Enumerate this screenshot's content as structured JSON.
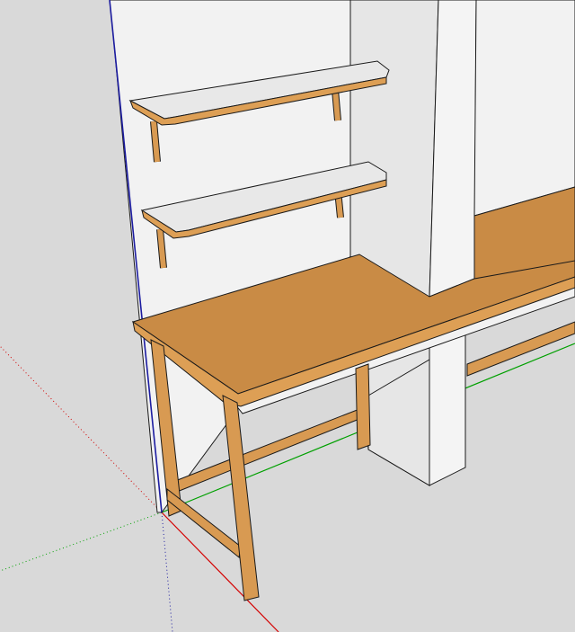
{
  "scene": {
    "description_visible_text": "",
    "colors": {
      "background": "#d9d9d9",
      "wall": "#f2f2f2",
      "wall_shade": "#e4e4e4",
      "shelf_top": "#e8e8e8",
      "wood_top": "#c98b45",
      "wood_edge": "#dd9f55",
      "wood_leg": "#d89a52",
      "outline": "#1a1a1a",
      "axis_red": "#d40000",
      "axis_green": "#00a000",
      "axis_blue": "#1c1ca0"
    }
  }
}
